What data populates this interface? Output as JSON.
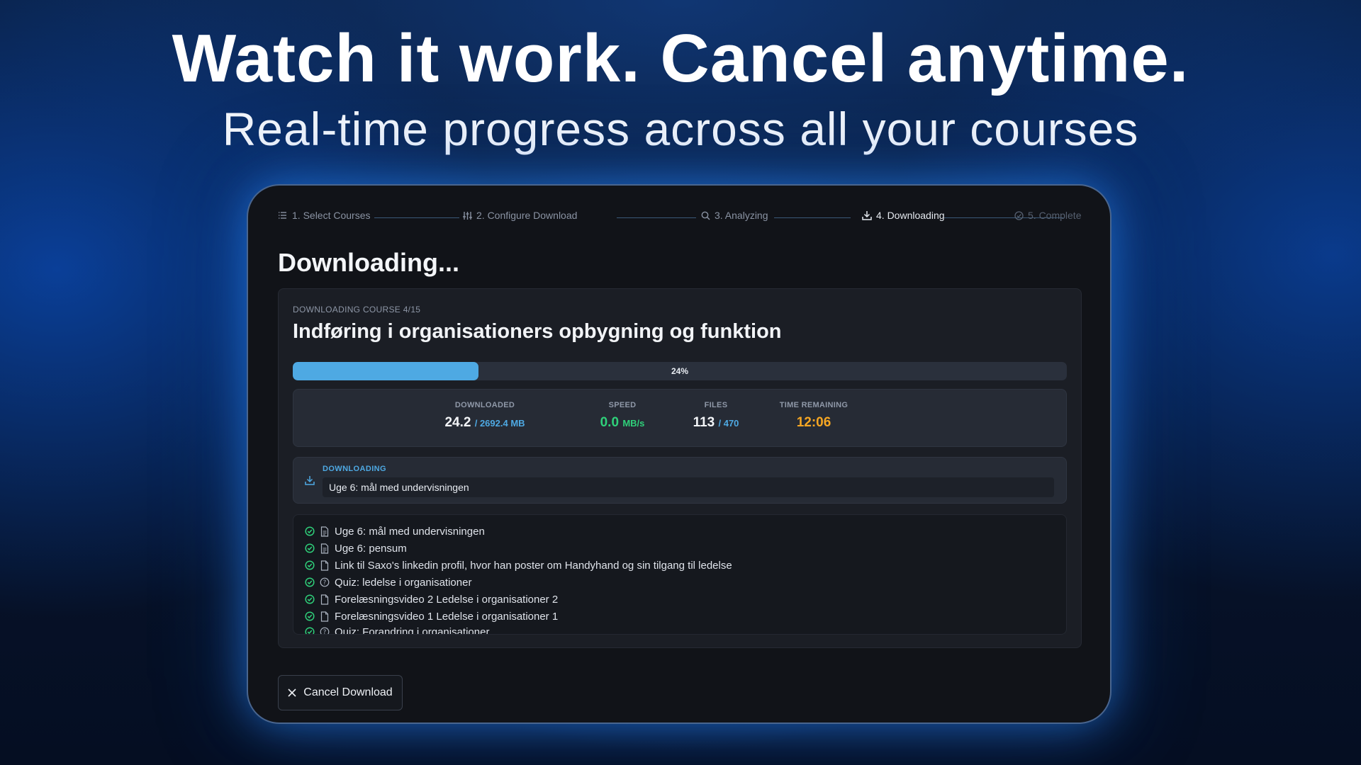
{
  "hero": {
    "title": "Watch it work. Cancel anytime.",
    "subtitle": "Real-time progress across all your courses"
  },
  "stepper": {
    "steps": [
      {
        "label": "1. Select Courses",
        "icon": "list-icon",
        "state": "done"
      },
      {
        "label": "2. Configure Download",
        "icon": "sliders-icon",
        "state": "done"
      },
      {
        "label": "3. Analyzing",
        "icon": "search-icon",
        "state": "done"
      },
      {
        "label": "4. Downloading",
        "icon": "download-icon",
        "state": "active"
      },
      {
        "label": "5. Complete",
        "icon": "check-circle-icon",
        "state": "future"
      }
    ]
  },
  "page": {
    "heading": "Downloading..."
  },
  "course": {
    "counter": "DOWNLOADING COURSE 4/15",
    "title": "Indføring i organisationers opbygning og funktion"
  },
  "progress": {
    "percent": 24,
    "label": "24%"
  },
  "stats": {
    "downloaded": {
      "label": "DOWNLOADED",
      "value": "24.2",
      "total": "/ 2692.4 MB"
    },
    "speed": {
      "label": "SPEED",
      "value": "0.0",
      "unit": "MB/s"
    },
    "files": {
      "label": "FILES",
      "value": "113",
      "total": "/ 470"
    },
    "time_remaining": {
      "label": "TIME REMAINING",
      "value": "12:06"
    }
  },
  "current": {
    "label": "DOWNLOADING",
    "file": "Uge 6: mål med undervisningen"
  },
  "files": [
    {
      "name": "Uge 6: mål med undervisningen",
      "icon": "document-text-icon"
    },
    {
      "name": "Uge 6: pensum",
      "icon": "document-text-icon"
    },
    {
      "name": "Link til Saxo's linkedin profil, hvor han poster om Handyhand og sin tilgang til ledelse",
      "icon": "file-icon"
    },
    {
      "name": "Quiz: ledelse i organisationer",
      "icon": "question-circle-icon"
    },
    {
      "name": "Forelæsningsvideo 2 Ledelse i organisationer 2",
      "icon": "file-icon"
    },
    {
      "name": "Forelæsningsvideo 1 Ledelse i organisationer 1",
      "icon": "file-icon"
    },
    {
      "name": "Quiz: Forandring i organisationer",
      "icon": "question-circle-icon"
    }
  ],
  "actions": {
    "cancel_label": "Cancel Download"
  },
  "colors": {
    "accent": "#4ea9e3",
    "success": "#2fd07a",
    "warning": "#f5a623"
  }
}
